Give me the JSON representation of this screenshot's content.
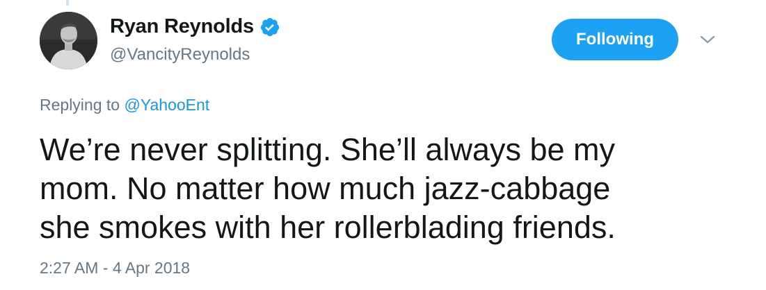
{
  "tweet": {
    "author": {
      "display_name": "Ryan Reynolds",
      "handle": "@VancityReynolds",
      "verified": true
    },
    "follow_button_label": "Following",
    "reply_context": {
      "prefix": "Replying to",
      "mention": "@YahooEnt"
    },
    "text_lines": [
      "We’re never splitting. She’ll always be my",
      "mom. No matter how much jazz-cabbage",
      "she smokes with her rollerblading friends."
    ],
    "timestamp": "2:27 AM - 4 Apr 2018"
  },
  "icons": {
    "verified": "verified-badge-icon",
    "caret": "chevron-down-icon"
  },
  "colors": {
    "brand_blue": "#1da1f2",
    "link_blue": "#1b95e0",
    "secondary_text": "#657786",
    "primary_text": "#14171a"
  }
}
